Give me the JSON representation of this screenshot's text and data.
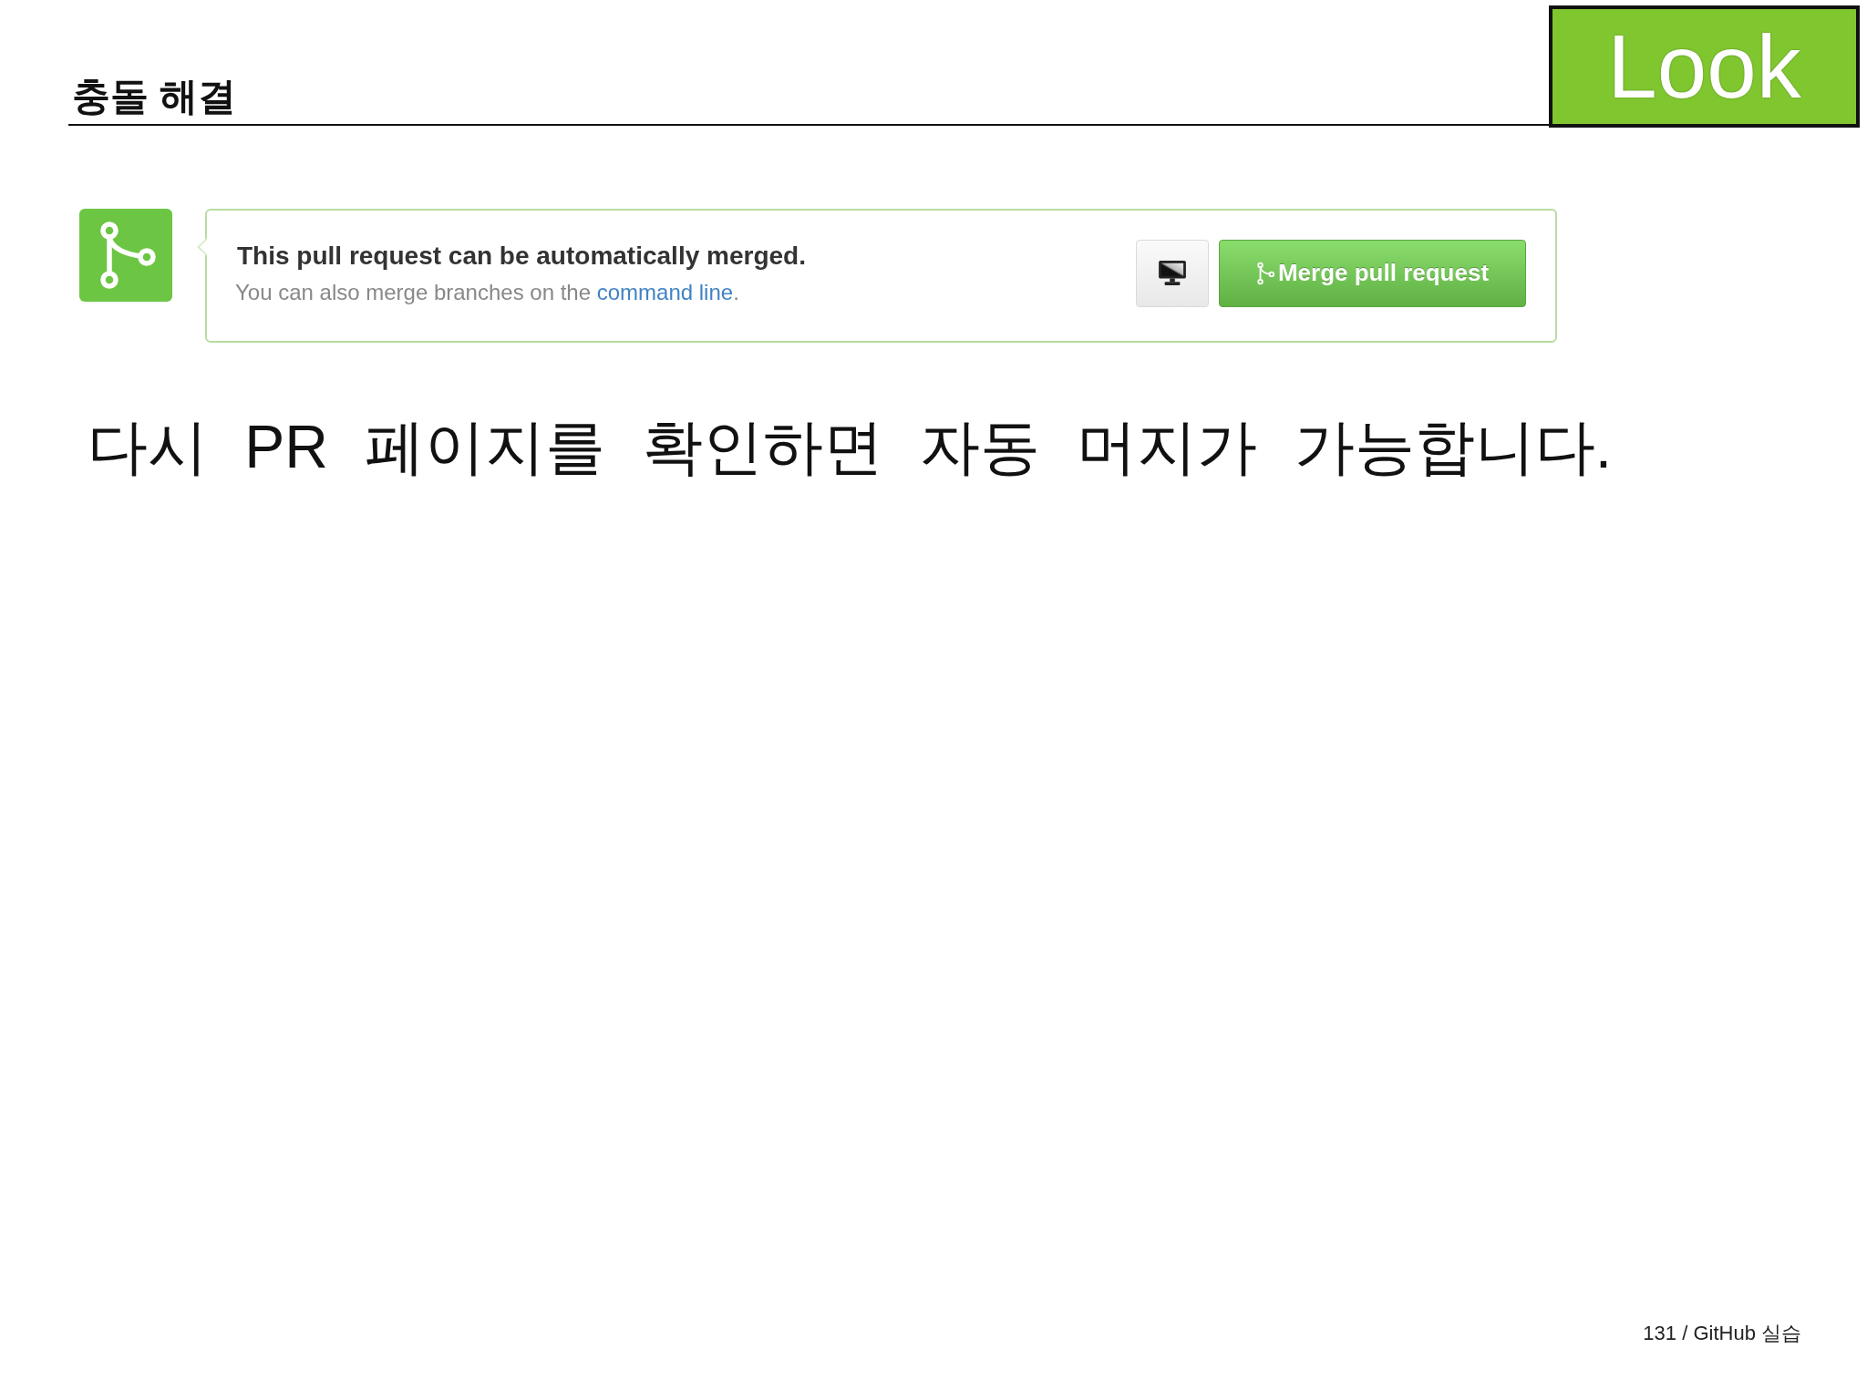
{
  "header": {
    "title": "충돌 해결",
    "badge": "Look"
  },
  "merge_panel": {
    "status": "This pull request can be automatically merged.",
    "hint": {
      "before": "You can also merge branches on the ",
      "link": "command line",
      "after": "."
    },
    "button": "Merge pull request"
  },
  "caption": "다시 PR 페이지를 확인하면 자동 머지가 가능합니다.",
  "footer": "131 / GitHub 실습"
}
